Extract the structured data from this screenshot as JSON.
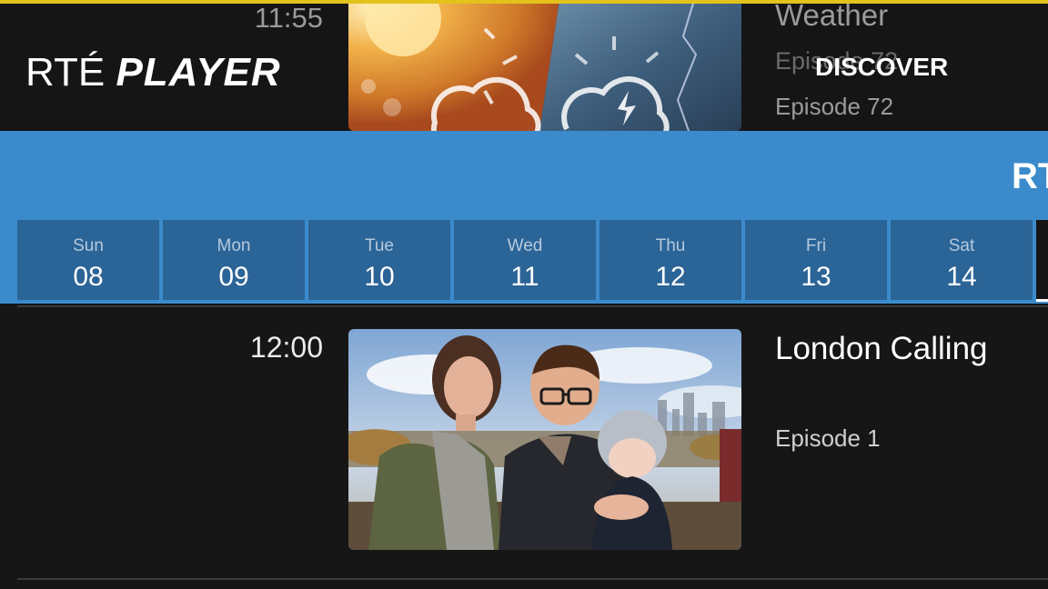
{
  "header": {
    "logo_rte": "RTÉ",
    "logo_player": "PLAYER",
    "nav_discover": "DISCOVER"
  },
  "previous_listing": {
    "time": "11:55",
    "title": "Weather",
    "episode_faded": "Episode 72",
    "episode": "Episode 72"
  },
  "schedule": {
    "channel_label_partial": "RT",
    "days": [
      {
        "name": "Sun",
        "date": "08"
      },
      {
        "name": "Mon",
        "date": "09"
      },
      {
        "name": "Tue",
        "date": "10"
      },
      {
        "name": "Wed",
        "date": "11"
      },
      {
        "name": "Thu",
        "date": "12"
      },
      {
        "name": "Fri",
        "date": "13"
      },
      {
        "name": "Sat",
        "date": "14"
      }
    ]
  },
  "current_listing": {
    "time": "12:00",
    "title": "London Calling",
    "episode": "Episode 1"
  },
  "colors": {
    "accent_blue": "#3b8bcc",
    "day_tile": "#2b6497",
    "background": "#161616",
    "focus_line": "#e3c21b"
  }
}
